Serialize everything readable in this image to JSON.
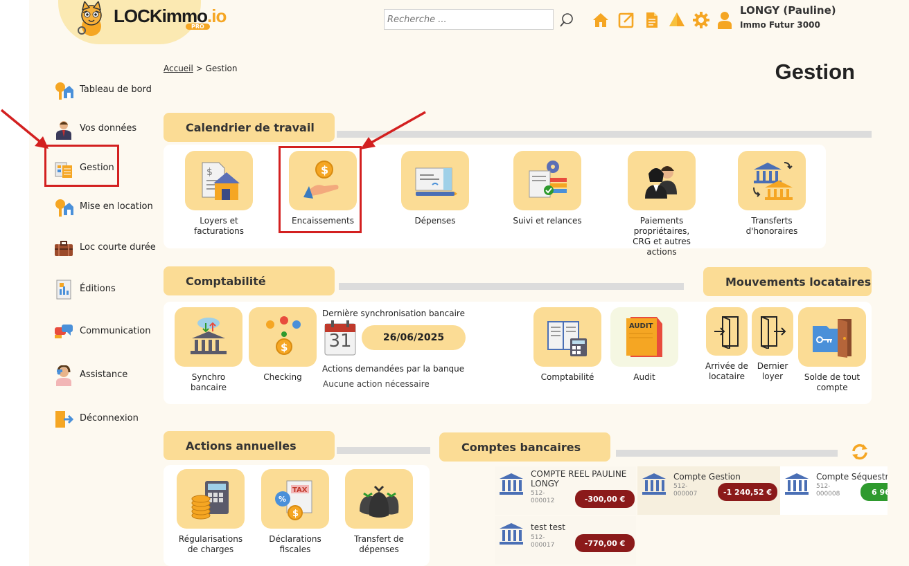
{
  "header": {
    "logo_main": "LOCKimmo",
    "logo_suffix": ".io",
    "logo_badge": "PRO",
    "search_placeholder": "Recherche ...",
    "user_name": "LONGY (Pauline)",
    "user_org": "Immo Futur 3000",
    "icons": [
      "search-icon",
      "home-icon",
      "external-link-icon",
      "document-icon",
      "tent-icon",
      "gear-icon",
      "user-icon"
    ]
  },
  "sidebar": {
    "items": [
      {
        "label": "Tableau de bord",
        "icon": "dashboard-icon"
      },
      {
        "label": "Vos données",
        "icon": "person-icon"
      },
      {
        "label": "Gestion",
        "icon": "management-icon"
      },
      {
        "label": "Mise en location",
        "icon": "rental-icon"
      },
      {
        "label": "Loc courte durée",
        "icon": "suitcase-icon"
      },
      {
        "label": "Éditions",
        "icon": "report-icon"
      },
      {
        "label": "Communication",
        "icon": "chat-icon"
      },
      {
        "label": "Assistance",
        "icon": "support-icon"
      },
      {
        "label": "Déconnexion",
        "icon": "logout-icon"
      }
    ]
  },
  "breadcrumb": {
    "home": "Accueil",
    "separator": ">",
    "current": "Gestion"
  },
  "page_title": "Gestion",
  "calendrier": {
    "title": "Calendrier de travail",
    "tiles": [
      {
        "label": "Loyers et facturations"
      },
      {
        "label": "Encaissements"
      },
      {
        "label": "Dépenses"
      },
      {
        "label": "Suivi et relances"
      },
      {
        "label": "Paiements propriétaires, CRG et autres actions"
      },
      {
        "label": "Transferts d'honoraires"
      }
    ]
  },
  "comptabilite": {
    "title": "Comptabilité",
    "tiles": [
      {
        "label": "Synchro bancaire"
      },
      {
        "label": "Checking"
      },
      {
        "label": "Comptabilité"
      },
      {
        "label": "Audit"
      }
    ],
    "sync_title": "Dernière synchronisation bancaire",
    "calendar_day": "31",
    "sync_date": "26/06/2025",
    "bank_actions_label": "Actions demandées par la banque",
    "bank_actions_value": "Aucune action nécessaire"
  },
  "mouvements": {
    "title": "Mouvements locataires",
    "tiles": [
      {
        "label": "Arrivée de locataire"
      },
      {
        "label": "Dernier loyer"
      },
      {
        "label": "Solde de tout compte"
      }
    ]
  },
  "actions_annuelles": {
    "title": "Actions annuelles",
    "tiles": [
      {
        "label": "Régularisations de charges"
      },
      {
        "label": "Déclarations fiscales"
      },
      {
        "label": "Transfert de dépenses"
      }
    ]
  },
  "comptes": {
    "title": "Comptes bancaires",
    "accounts": [
      {
        "name": "COMPTE REEL PAULINE LONGY",
        "number": "512-000012",
        "amount": "-300,00 €",
        "color": "#8b1a1a"
      },
      {
        "name": "Compte Gestion",
        "number": "512-000007",
        "amount": "-1 240,52 €",
        "color": "#8b1a1a"
      },
      {
        "name": "Compte Séquestr",
        "number": "512-000008",
        "amount": "6 96",
        "color": "#2e9a2e"
      },
      {
        "name": "test test",
        "number": "512-000017",
        "amount": "-770,00 €",
        "color": "#8b1a1a"
      }
    ]
  },
  "colors": {
    "accent": "#fbdc95",
    "brand": "#f5a623",
    "highlight": "#d32020"
  }
}
